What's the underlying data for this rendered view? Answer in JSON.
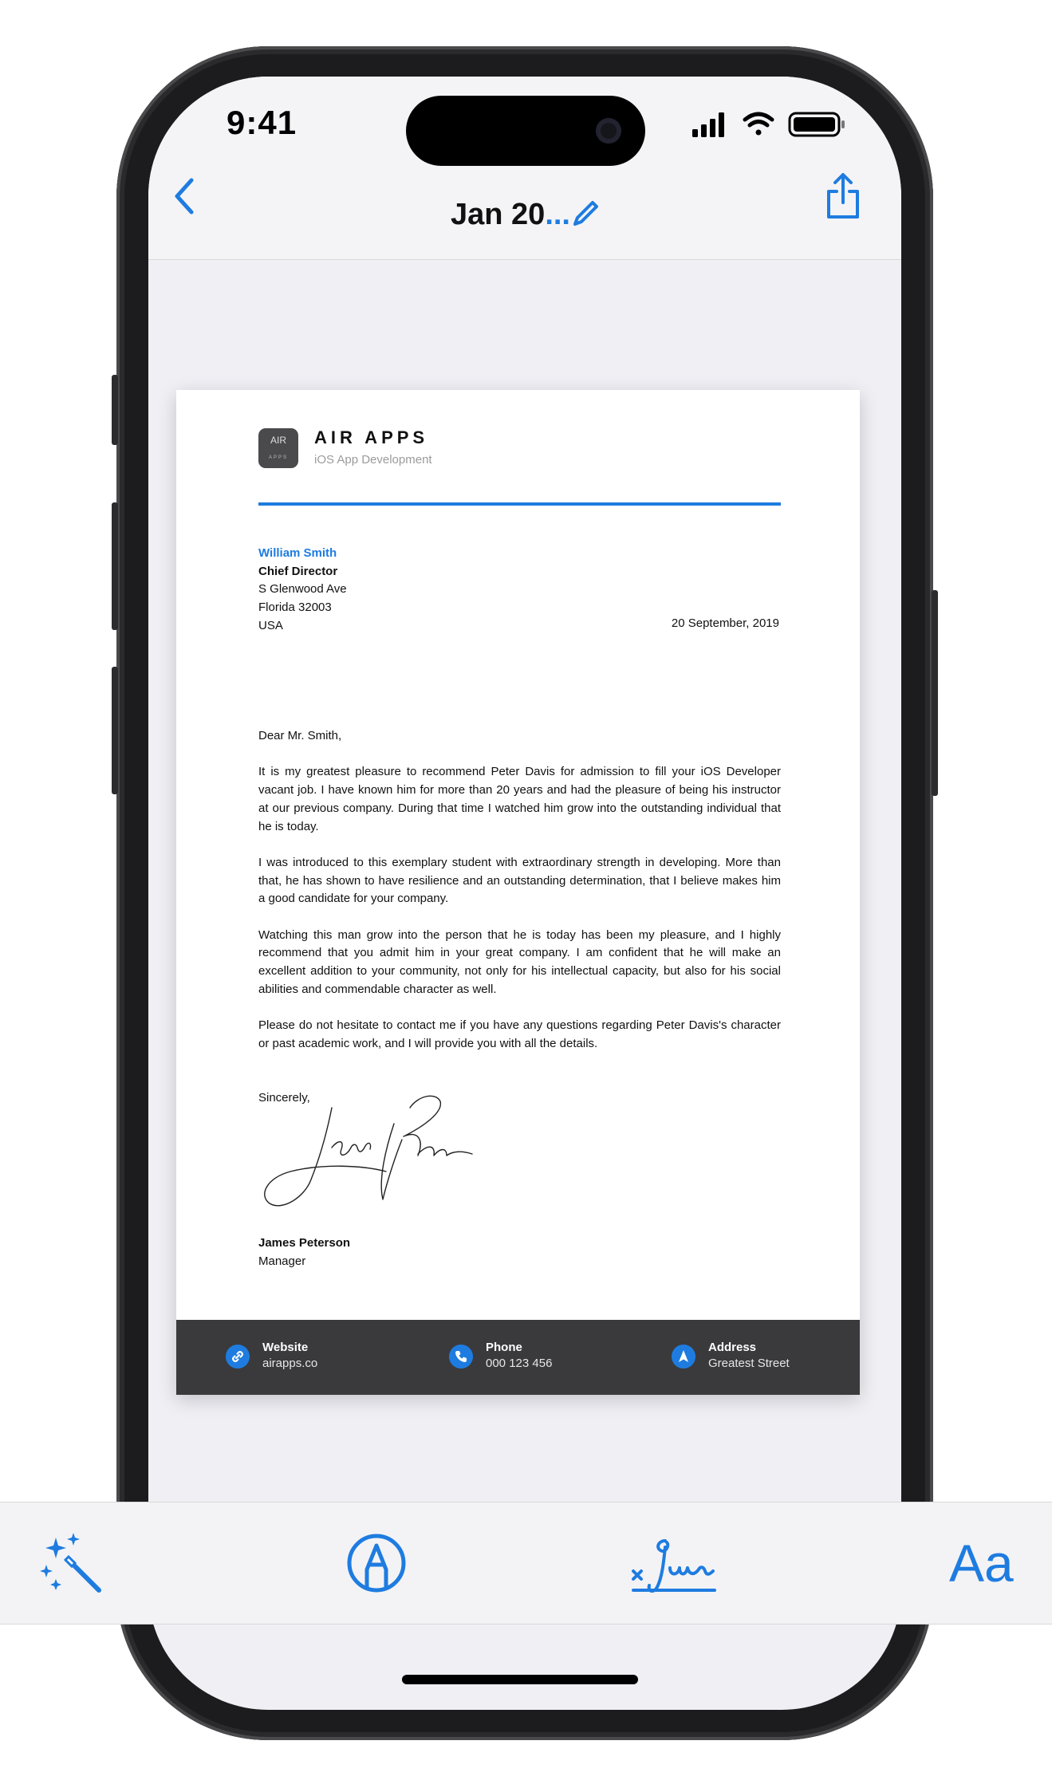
{
  "status_bar": {
    "time": "9:41"
  },
  "nav": {
    "title": "Jan 20",
    "title_ellipsis": "..."
  },
  "letterhead": {
    "logo_text": "AIR",
    "logo_subtext": "APPS",
    "company": "AIR APPS",
    "tagline": "iOS App Development"
  },
  "recipient": {
    "name": "William Smith",
    "title": "Chief Director",
    "street": "S Glenwood Ave",
    "city": "Florida 32003",
    "country": "USA"
  },
  "date": "20 September, 2019",
  "letter": {
    "greeting": "Dear Mr. Smith,",
    "paragraphs": [
      "It is my greatest pleasure to recommend Peter Davis for admission to fill your iOS Developer vacant job. I have known him for more than 20 years and had the pleasure of being his instructor at our previous company. During that time I watched him grow into the outstanding individual that he is today.",
      "I was introduced to this exemplary student with extraordinary strength in developing. More than that, he has shown to have resilience and an outstanding determination, that I believe makes him a good candidate for your company.",
      "Watching this man grow into the person that he is today has been my pleasure, and I highly recommend that you admit him in your great company. I am confident that he will make an excellent addition to your community, not only for his intellectual capacity, but also for his social abilities and commendable character as well.",
      "Please do not hesitate to contact me if you have any questions regarding Peter Davis's character or past academic work, and I will provide you with all the details."
    ],
    "closing": "Sincerely,",
    "signer_name": "James Peterson",
    "signer_title": "Manager"
  },
  "footer": [
    {
      "label": "Website",
      "value": "airapps.co",
      "icon": "link-icon"
    },
    {
      "label": "Phone",
      "value": "000 123 456",
      "icon": "phone-icon"
    },
    {
      "label": "Address",
      "value": "Greatest Street",
      "icon": "location-arrow-icon"
    }
  ],
  "toolbar": {
    "text_tool_label": "Aa",
    "icons": [
      "magic-wand-icon",
      "markup-pen-icon",
      "signature-icon",
      "text-format-icon"
    ]
  },
  "colors": {
    "accent": "#1e7ce0",
    "footer_bg": "#3a3a3c",
    "screen_bg": "#efeff4"
  }
}
